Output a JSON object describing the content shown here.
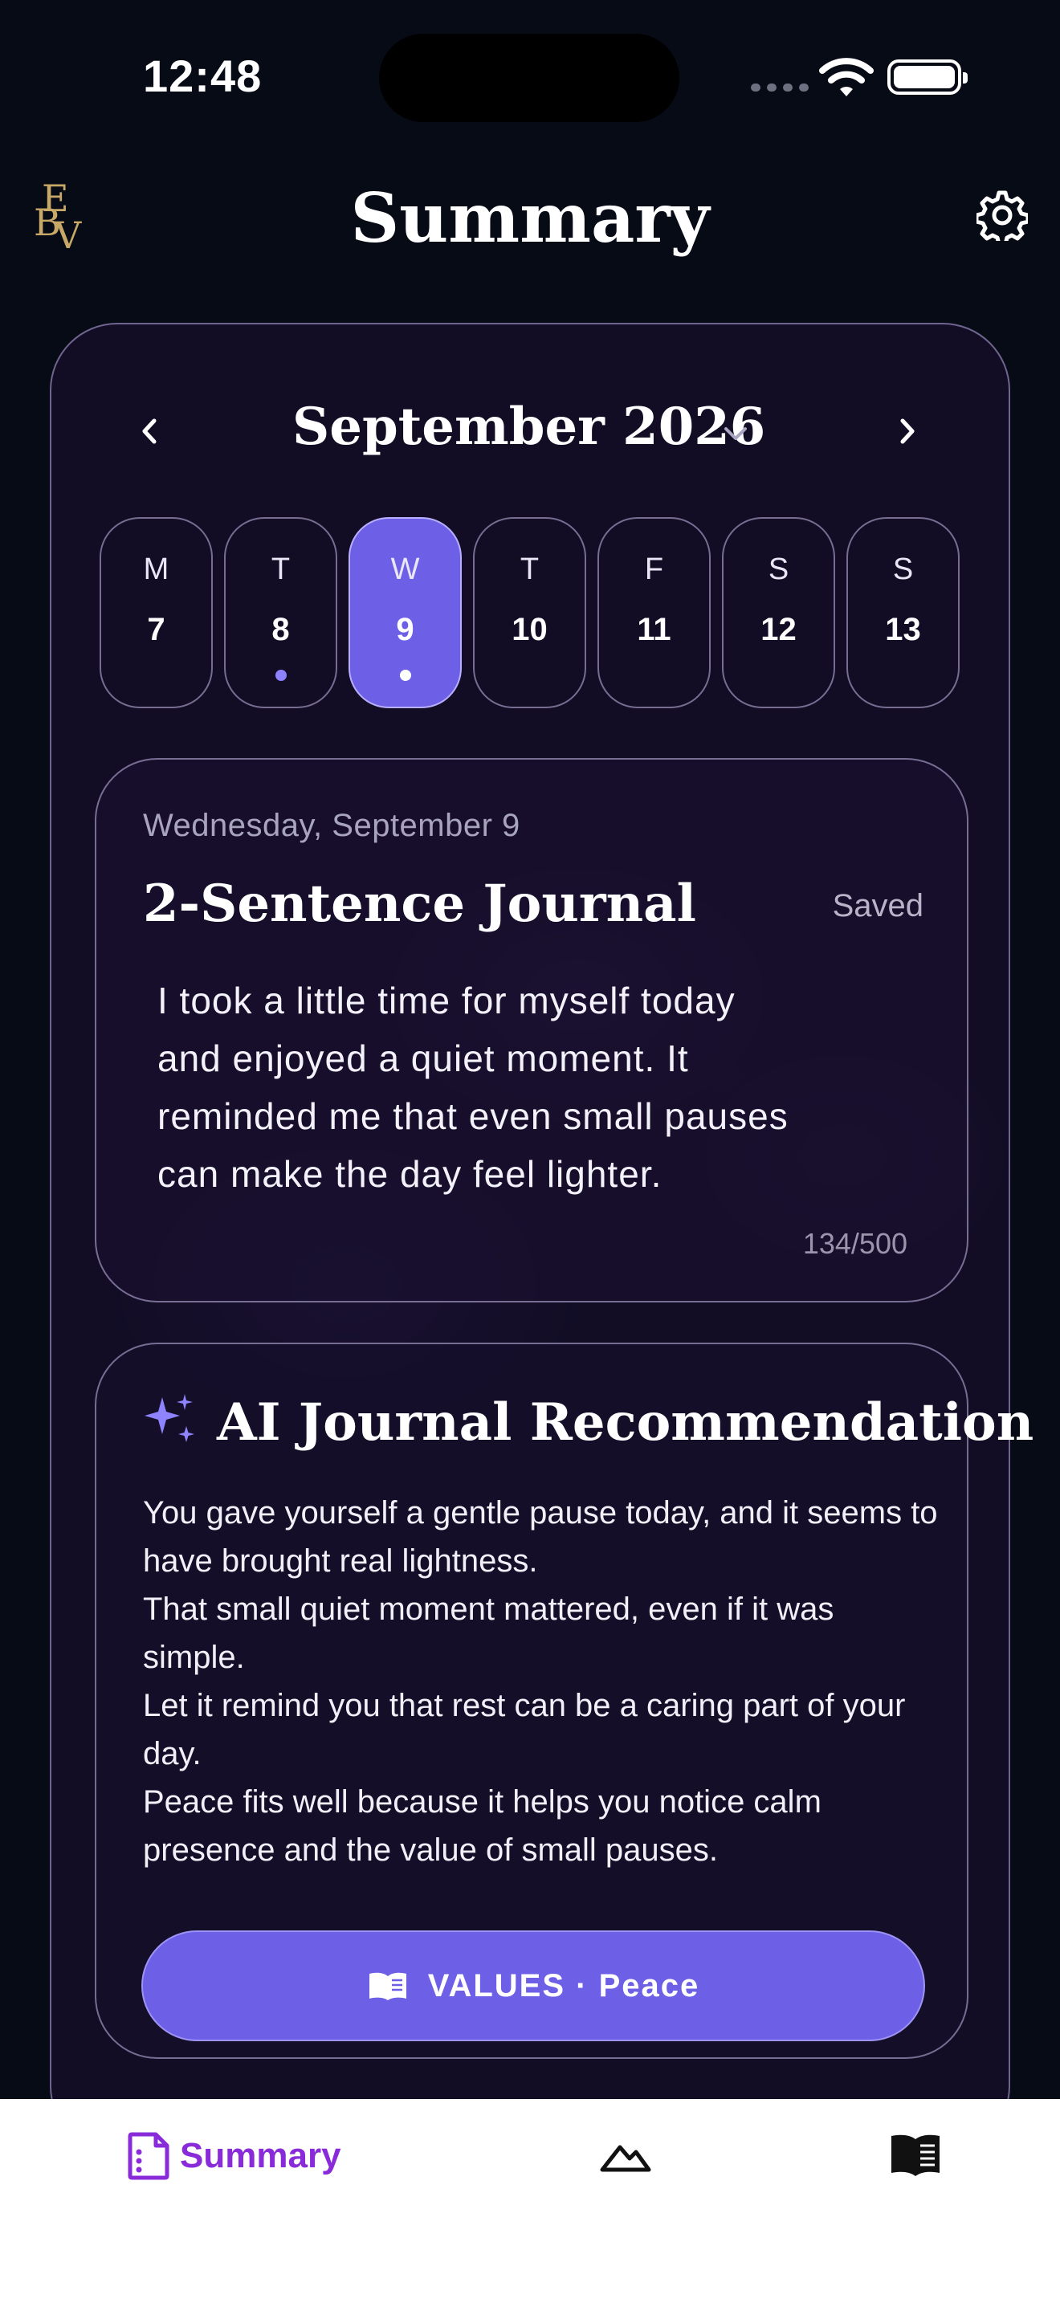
{
  "status_bar": {
    "time": "12:48"
  },
  "header": {
    "title": "Summary",
    "logo_text": [
      "E",
      "B",
      "V"
    ],
    "logo_color": "#c7a867"
  },
  "calendar": {
    "month": "September 2026",
    "days": [
      {
        "letter": "M",
        "number": "7",
        "selected": false,
        "has_entry": false
      },
      {
        "letter": "T",
        "number": "8",
        "selected": false,
        "has_entry": true
      },
      {
        "letter": "W",
        "number": "9",
        "selected": true,
        "has_entry": true
      },
      {
        "letter": "T",
        "number": "10",
        "selected": false,
        "has_entry": false
      },
      {
        "letter": "F",
        "number": "11",
        "selected": false,
        "has_entry": false
      },
      {
        "letter": "S",
        "number": "12",
        "selected": false,
        "has_entry": false
      },
      {
        "letter": "S",
        "number": "13",
        "selected": false,
        "has_entry": false
      }
    ]
  },
  "journal": {
    "date": "Wednesday, September 9",
    "title": "2-Sentence Journal",
    "status": "Saved",
    "body_lines": [
      "I took a little time for myself today",
      "and enjoyed a quiet moment. It",
      "reminded me that even small pauses",
      "can make the day feel lighter."
    ],
    "char_count": "134/500"
  },
  "ai": {
    "title": "AI Journal Recommendation",
    "paragraphs": [
      "You gave yourself a gentle pause today, and it seems to have brought real lightness.",
      "That small quiet moment mattered, even if it was simple.",
      "Let it remind you that rest can be a caring part of your day.",
      "Peace fits well because it helps you notice calm presence and the value of small pauses."
    ],
    "button_label": "VALUES · Peace"
  },
  "tab_bar": {
    "summary_label": "Summary",
    "active_color": "#8a2bd9"
  },
  "colors": {
    "accent": "#6d5fe6",
    "background": "#070b16"
  }
}
